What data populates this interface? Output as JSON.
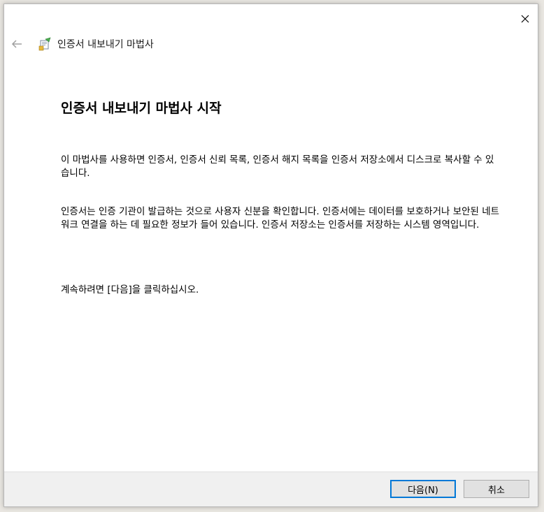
{
  "header": {
    "title": "인증서 내보내기 마법사",
    "back_icon": "back-arrow-icon",
    "close_icon": "close-icon"
  },
  "main": {
    "heading": "인증서 내보내기 마법사 시작",
    "paragraphs": [
      "이 마법사를 사용하면 인증서, 인증서 신뢰 목록, 인증서 해지 목록을 인증서 저장소에서 디스크로 복사할 수 있습니다.",
      "인증서는 인증 기관이 발급하는 것으로 사용자 신분을 확인합니다. 인증서에는 데이터를 보호하거나 보안된 네트워크 연결을 하는 데 필요한 정보가 들어 있습니다. 인증서 저장소는 인증서를 저장하는 시스템 영역입니다.",
      "계속하려면 [다음]을 클릭하십시오."
    ]
  },
  "footer": {
    "next_label": "다음(N)",
    "cancel_label": "취소"
  },
  "colors": {
    "accent": "#0078d7",
    "footer_bg": "#f0f0f0"
  }
}
